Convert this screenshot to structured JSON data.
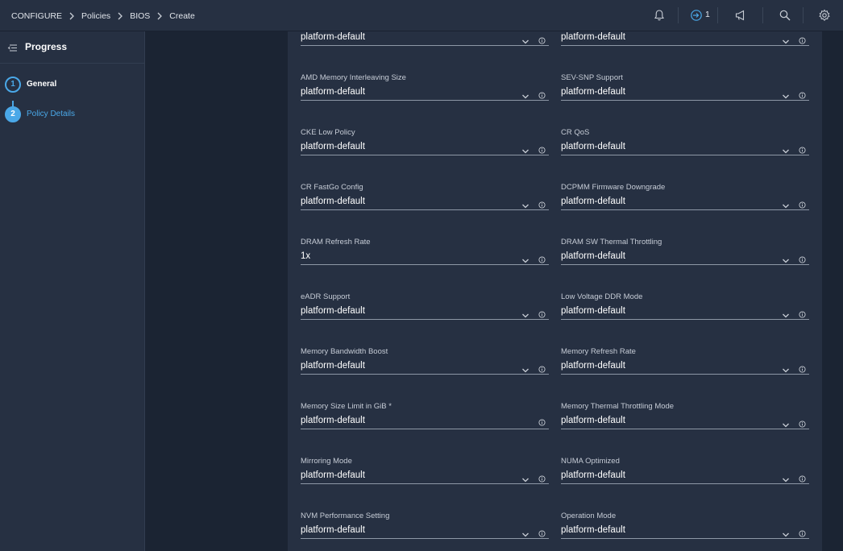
{
  "breadcrumb": [
    "CONFIGURE",
    "Policies",
    "BIOS",
    "Create"
  ],
  "topbar": {
    "icons": [
      "bell-icon",
      "login-arrow-icon",
      "megaphone-icon",
      "search-icon",
      "gear-icon"
    ],
    "alert_count": "1"
  },
  "sidebar": {
    "title": "Progress",
    "steps": [
      {
        "number": "1",
        "label": "General"
      },
      {
        "number": "2",
        "label": "Policy Details"
      }
    ]
  },
  "colors": {
    "accent": "#4aa8e8",
    "panel": "#263042",
    "background": "#1b2433"
  },
  "fields": [
    {
      "label": "",
      "value": "platform-default",
      "type": "select"
    },
    {
      "label": "",
      "value": "platform-default",
      "type": "select"
    },
    {
      "label": "AMD Memory Interleaving Size",
      "value": "platform-default",
      "type": "select"
    },
    {
      "label": "SEV-SNP Support",
      "value": "platform-default",
      "type": "select"
    },
    {
      "label": "CKE Low Policy",
      "value": "platform-default",
      "type": "select"
    },
    {
      "label": "CR QoS",
      "value": "platform-default",
      "type": "select"
    },
    {
      "label": "CR FastGo Config",
      "value": "platform-default",
      "type": "select"
    },
    {
      "label": "DCPMM Firmware Downgrade",
      "value": "platform-default",
      "type": "select"
    },
    {
      "label": "DRAM Refresh Rate",
      "value": "1x",
      "type": "select"
    },
    {
      "label": "DRAM SW Thermal Throttling",
      "value": "platform-default",
      "type": "select"
    },
    {
      "label": "eADR Support",
      "value": "platform-default",
      "type": "select"
    },
    {
      "label": "Low Voltage DDR Mode",
      "value": "platform-default",
      "type": "select"
    },
    {
      "label": "Memory Bandwidth Boost",
      "value": "platform-default",
      "type": "select"
    },
    {
      "label": "Memory Refresh Rate",
      "value": "platform-default",
      "type": "select"
    },
    {
      "label": "Memory Size Limit in GiB *",
      "value": "platform-default",
      "type": "text"
    },
    {
      "label": "Memory Thermal Throttling Mode",
      "value": "platform-default",
      "type": "select"
    },
    {
      "label": "Mirroring Mode",
      "value": "platform-default",
      "type": "select"
    },
    {
      "label": "NUMA Optimized",
      "value": "platform-default",
      "type": "select"
    },
    {
      "label": "NVM Performance Setting",
      "value": "platform-default",
      "type": "select"
    },
    {
      "label": "Operation Mode",
      "value": "platform-default",
      "type": "select"
    }
  ]
}
